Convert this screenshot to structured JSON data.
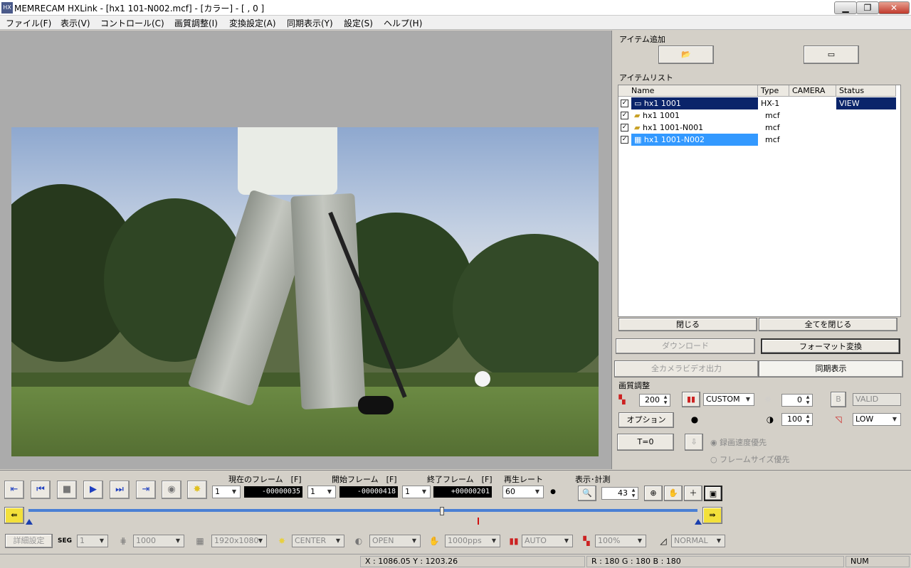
{
  "window": {
    "title": "MEMRECAM HXLink - [hx1 101-N002.mcf] - [カラー] - [   , 0 ]",
    "minimize": "▁",
    "restore": "❐",
    "close": "✕"
  },
  "menu": [
    "ファイル(F)",
    "表示(V)",
    "コントロール(C)",
    "画質調整(I)",
    "変換設定(A)",
    "同期表示(Y)",
    "設定(S)",
    "ヘルプ(H)"
  ],
  "item_add": {
    "label": "アイテム追加",
    "open_icon": "folder-open-icon",
    "camera_icon": "camera-icon"
  },
  "item_list": {
    "label": "アイテムリスト",
    "columns": [
      "Name",
      "Type",
      "CAMERA",
      "Status"
    ],
    "rows": [
      {
        "name": "hx1 1001",
        "type": "HX-1",
        "camera": "",
        "status": "VIEW",
        "icon": "camera-icon"
      },
      {
        "name": "hx1 1001",
        "type": "mcf",
        "camera": "",
        "status": "",
        "icon": "folder-icon"
      },
      {
        "name": "hx1 1001-N001",
        "type": "mcf",
        "camera": "",
        "status": "",
        "icon": "folder-icon"
      },
      {
        "name": "hx1 1001-N002",
        "type": "mcf",
        "camera": "",
        "status": "",
        "icon": "film-icon"
      }
    ],
    "close": "閉じる",
    "close_all": "全てを閉じる"
  },
  "actions": {
    "download": "ダウンロード",
    "format_convert": "フォーマット変換",
    "all_camera_video": "全カメラビデオ出力",
    "sync_display": "同期表示"
  },
  "image_adjust": {
    "label": "画質調整",
    "gain": "200",
    "mode": "CUSTOM",
    "offset": "0",
    "valid": "VALID",
    "option": "オプション",
    "contrast": "100",
    "level": "LOW"
  },
  "trigger": {
    "t0": "T=0",
    "rec_speed": "録画速度優先",
    "frame_size": "フレームサイズ優先"
  },
  "playback": {
    "current_label": "現在のフレーム　[F]",
    "start_label": "開始フレーム　[F]",
    "end_label": "終了フレーム　[F]",
    "rate_label": "再生レート",
    "current_step": "1",
    "current_value": "-00000035",
    "start_step": "1",
    "start_value": "-00000418",
    "end_step": "1",
    "end_value": "+00000201",
    "rate": "60",
    "display_label": "表示･計測",
    "zoom": "43"
  },
  "settings": {
    "detail": "詳細設定",
    "seg_icon": "SEG",
    "seg": "1",
    "frames": "1000",
    "resolution": "1920x1080",
    "center": "CENTER",
    "open": "OPEN",
    "pps": "1000pps",
    "auto": "AUTO",
    "percent": "100%",
    "normal": "NORMAL"
  },
  "status": {
    "coords": "X : 1086.05  Y : 1203.26",
    "rgb": "R : 180  G : 180  B : 180",
    "num": "NUM"
  }
}
